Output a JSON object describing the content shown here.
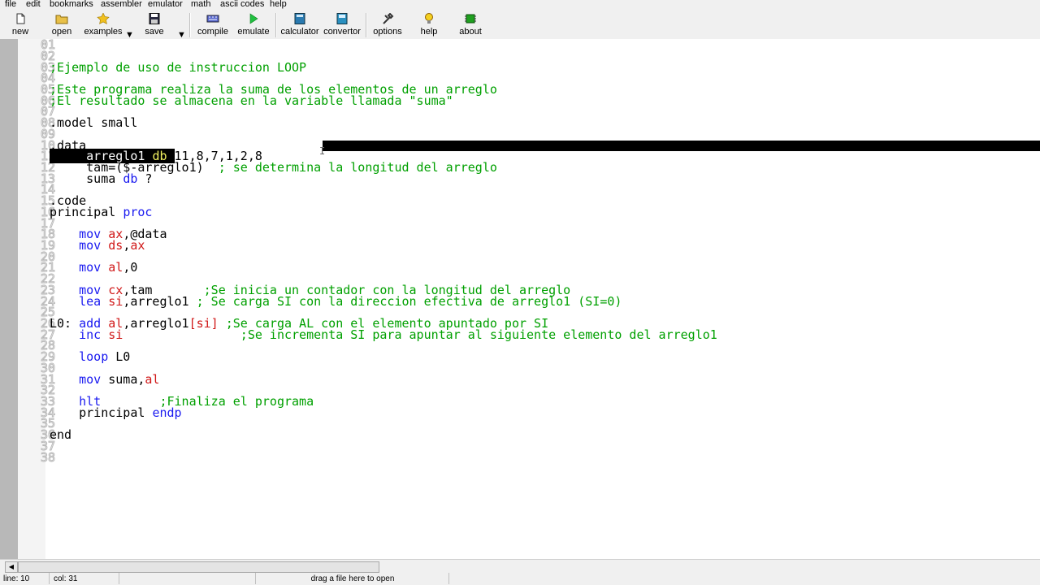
{
  "menu": [
    "file",
    "edit",
    "bookmarks",
    "assembler",
    "emulator",
    "math",
    "ascii codes",
    "help"
  ],
  "toolbar": {
    "new": "new",
    "open": "open",
    "examples": "examples",
    "save": "save",
    "compile": "compile",
    "emulate": "emulate",
    "calculator": "calculator",
    "convertor": "convertor",
    "options": "options",
    "help": "help",
    "about": "about"
  },
  "icons": {
    "new": "new-file-icon",
    "open": "open-folder-icon",
    "examples": "star-icon",
    "save": "floppy-disk-icon",
    "compile": "compile-icon",
    "emulate": "play-icon",
    "calculator": "calculator-icon",
    "convertor": "convertor-icon",
    "options": "tools-icon",
    "help": "lightbulb-icon",
    "about": "chip-icon"
  },
  "editor": {
    "line_numbers": [
      "01",
      "02",
      "03",
      "04",
      "05",
      "06",
      "07",
      "08",
      "09",
      "10",
      "11",
      "12",
      "13",
      "14",
      "15",
      "16",
      "17",
      "18",
      "19",
      "20",
      "21",
      "22",
      "23",
      "24",
      "25",
      "26",
      "27",
      "28",
      "29",
      "30",
      "31",
      "32",
      "33",
      "34",
      "35",
      "36",
      "37",
      "38"
    ],
    "code": {
      "l03": ";Ejemplo de uso de instruccion LOOP",
      "l05": ";Este programa realiza la suma de los elementos de un arreglo",
      "l06": ";El resultado se almacena en la variable llamada \"suma\"",
      "l08": ".model small",
      "l10": ".data",
      "l11_a": "     arreglo1 ",
      "l11_b": "db ",
      "l11_c": "11,8,7,1,2,8",
      "l12_a": "     tam=($-arreglo1)  ",
      "l12_b": "; se determina la longitud del arreglo",
      "l13_a": "     suma ",
      "l13_b": "db",
      "l13_c": " ?",
      "l15": ".code",
      "l16_a": "principal ",
      "l16_b": "proc",
      "l18_a": "    mov ",
      "l18_b": "ax",
      "l18_c": ",@data",
      "l19_a": "    mov ",
      "l19_b": "ds",
      "l19_c": ",",
      "l19_d": "ax",
      "l21_a": "    mov ",
      "l21_b": "al",
      "l21_c": ",0",
      "l23_a": "    mov ",
      "l23_b": "cx",
      "l23_c": ",tam       ",
      "l23_d": ";Se inicia un contador con la longitud del arreglo",
      "l24_a": "    lea ",
      "l24_b": "si",
      "l24_c": ",arreglo1 ",
      "l24_d": "; Se carga SI con la direccion efectiva de arreglo1 (SI=0)",
      "l26_a": "L0: ",
      "l26_b": "add ",
      "l26_c": "al",
      "l26_d": ",arreglo1",
      "l26_e": "[si]",
      "l26_f": " ;Se carga AL con el elemento apuntado por SI",
      "l27_a": "    inc ",
      "l27_b": "si",
      "l27_c": "                ;Se incrementa SI para apuntar al siguiente elemento del arreglo1",
      "l29_a": "    loop ",
      "l29_b": "L0",
      "l31_a": "    mov ",
      "l31_b": "suma,",
      "l31_c": "al",
      "l33_a": "    hlt        ",
      "l33_b": ";Finaliza el programa",
      "l34_a": "    principal ",
      "l34_b": "endp",
      "l36": "end"
    }
  },
  "status": {
    "line": "line: 10",
    "col": "col: 31",
    "hint": "drag a file here to open"
  },
  "colors": {
    "comment": "#00a000",
    "keyword": "#1a1af0",
    "register": "#d01818",
    "selection": "#000000"
  }
}
